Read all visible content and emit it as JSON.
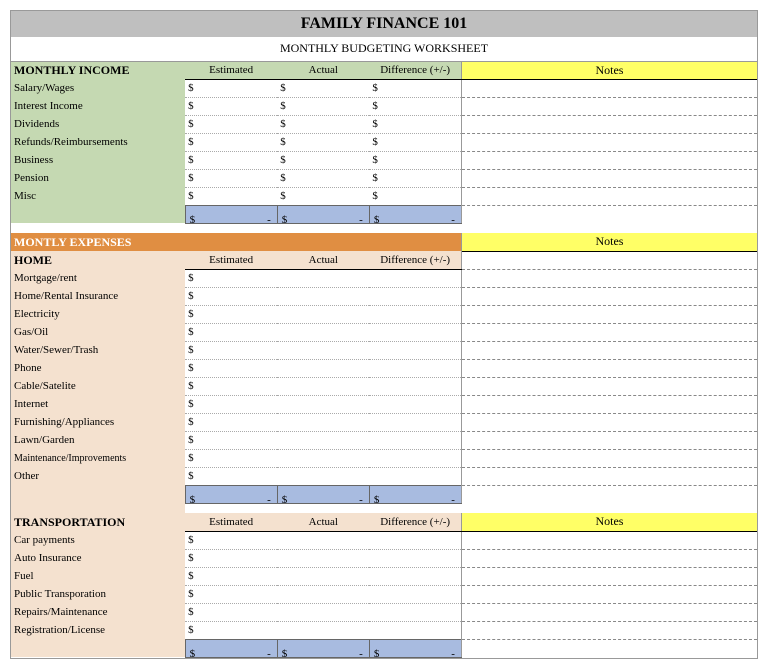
{
  "title": "FAMILY FINANCE 101",
  "subtitle": "MONTHLY BUDGETING WORKSHEET",
  "col_headers": {
    "estimated": "Estimated",
    "actual": "Actual",
    "difference": "Difference (+/-)",
    "notes": "Notes"
  },
  "currency": "$",
  "dash": "-",
  "sections": {
    "income": {
      "title": "MONTHLY INCOME",
      "rows": [
        "Salary/Wages",
        "Interest Income",
        "Dividends",
        "Refunds/Reimbursements",
        "Business",
        "Pension",
        "Misc"
      ]
    },
    "expenses": {
      "title": "MONTLY EXPENSES",
      "home": {
        "title": "HOME",
        "rows": [
          "Mortgage/rent",
          "Home/Rental Insurance",
          "Electricity",
          "Gas/Oil",
          "Water/Sewer/Trash",
          "Phone",
          "Cable/Satelite",
          "Internet",
          "Furnishing/Appliances",
          "Lawn/Garden",
          "Maintenance/Improvements",
          "Other"
        ]
      },
      "transportation": {
        "title": "TRANSPORTATION",
        "rows": [
          "Car payments",
          "Auto Insurance",
          "Fuel",
          "Public Transporation",
          "Repairs/Maintenance",
          "Registration/License"
        ]
      }
    }
  }
}
